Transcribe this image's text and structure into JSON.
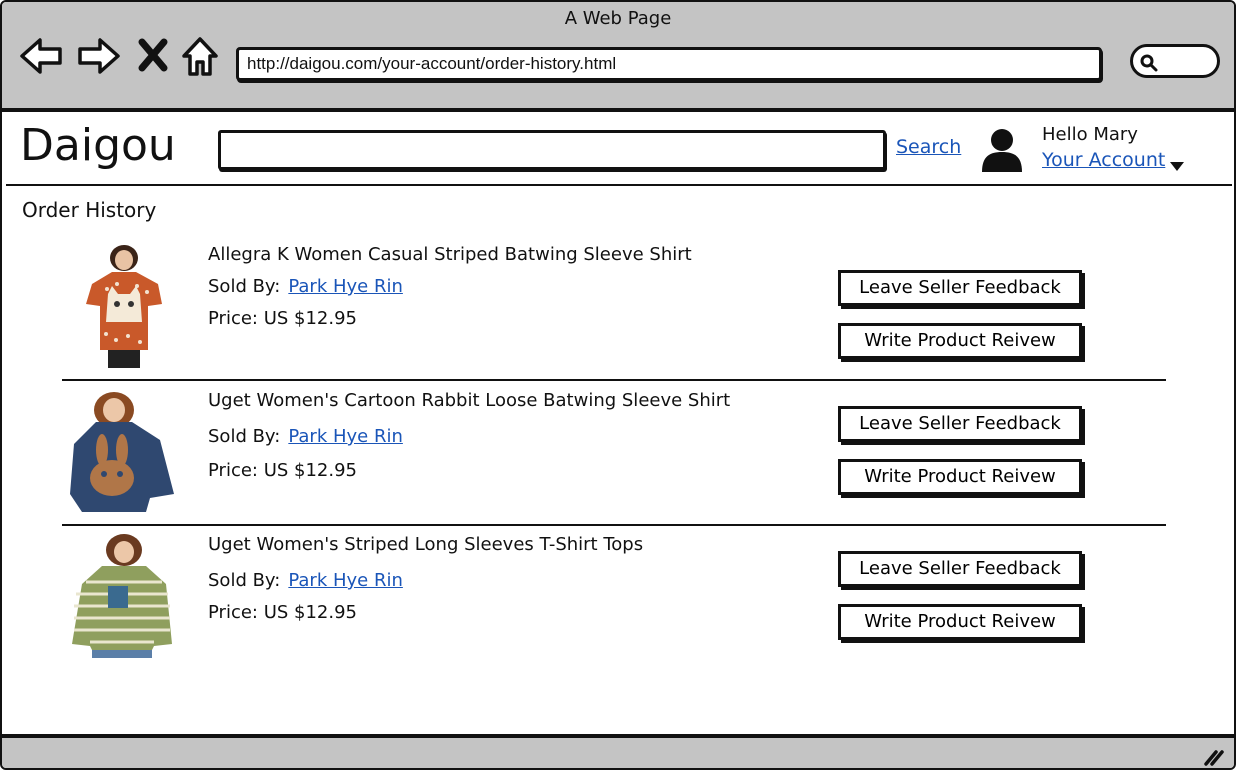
{
  "window": {
    "title": "A Web Page"
  },
  "browser": {
    "url": "http://daigou.com/your-account/order-history.html",
    "icons": [
      "back-arrow-icon",
      "forward-arrow-icon",
      "close-icon",
      "home-icon",
      "search-icon"
    ]
  },
  "header": {
    "logo": "Daigou",
    "search_value": "",
    "search_label": "Search",
    "greeting": "Hello Mary",
    "account_label": "Your Account"
  },
  "page": {
    "title": "Order History"
  },
  "orders": [
    {
      "name": "Allegra K Women Casual Striped Batwing Sleeve Shirt",
      "sold_by_label": "Sold By:",
      "seller": "Park Hye Rin",
      "price": "Price: US $12.95",
      "feedback_label": "Leave Seller Feedback",
      "review_label": "Write Product Reivew"
    },
    {
      "name": "Uget Women's Cartoon Rabbit Loose Batwing Sleeve Shirt",
      "sold_by_label": "Sold By:",
      "seller": "Park Hye Rin",
      "price": "Price: US $12.95",
      "feedback_label": "Leave Seller Feedback",
      "review_label": "Write Product Reivew"
    },
    {
      "name": "Uget Women's Striped Long Sleeves T-Shirt Tops",
      "sold_by_label": "Sold By:",
      "seller": "Park Hye Rin",
      "price": "Price: US $12.95",
      "feedback_label": "Leave Seller Feedback",
      "review_label": "Write Product Reivew"
    }
  ],
  "colors": {
    "link": "#1a55b8",
    "chrome": "#c4c4c4",
    "ink": "#111111"
  }
}
